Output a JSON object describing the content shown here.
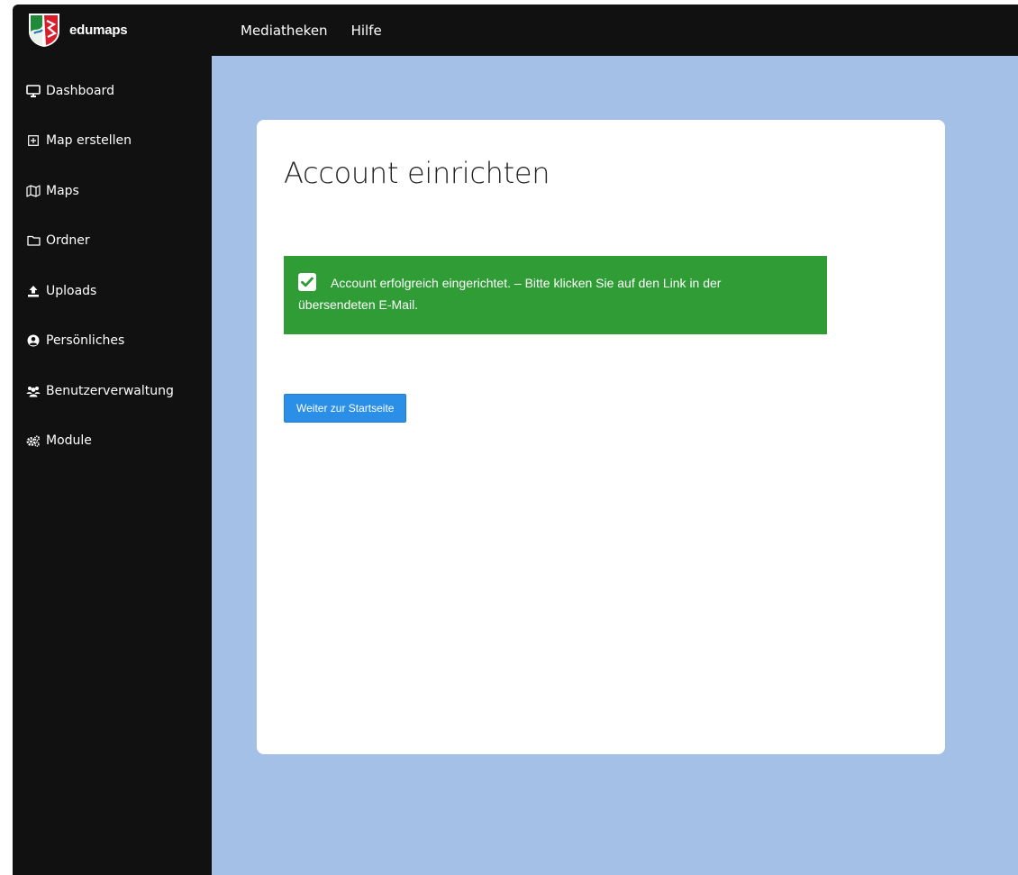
{
  "header": {
    "brand": "edumaps",
    "nav": [
      "Mediatheken",
      "Hilfe"
    ]
  },
  "sidebar": {
    "items": [
      {
        "label": "Dashboard",
        "icon": "monitor-icon"
      },
      {
        "label": "Map erstellen",
        "icon": "plus-square-icon"
      },
      {
        "label": "Maps",
        "icon": "map-icon"
      },
      {
        "label": "Ordner",
        "icon": "folder-icon"
      },
      {
        "label": "Uploads",
        "icon": "upload-icon"
      },
      {
        "label": "Persönliches",
        "icon": "user-circle-icon"
      },
      {
        "label": "Benutzerverwaltung",
        "icon": "users-icon"
      },
      {
        "label": "Module",
        "icon": "gears-icon"
      }
    ]
  },
  "main": {
    "title": "Account einrichten",
    "alert": {
      "line1": "Account erfolgreich eingerichtet. – Bitte klicken Sie auf den Link in der",
      "line2": "übersendeten E-Mail."
    },
    "button_label": "Weiter zur Startseite"
  },
  "colors": {
    "topbar": "#111111",
    "sidebar": "#111111",
    "background": "#a4c0e6",
    "alert_success": "#2f9c36",
    "primary_button": "#2b8fe8"
  }
}
